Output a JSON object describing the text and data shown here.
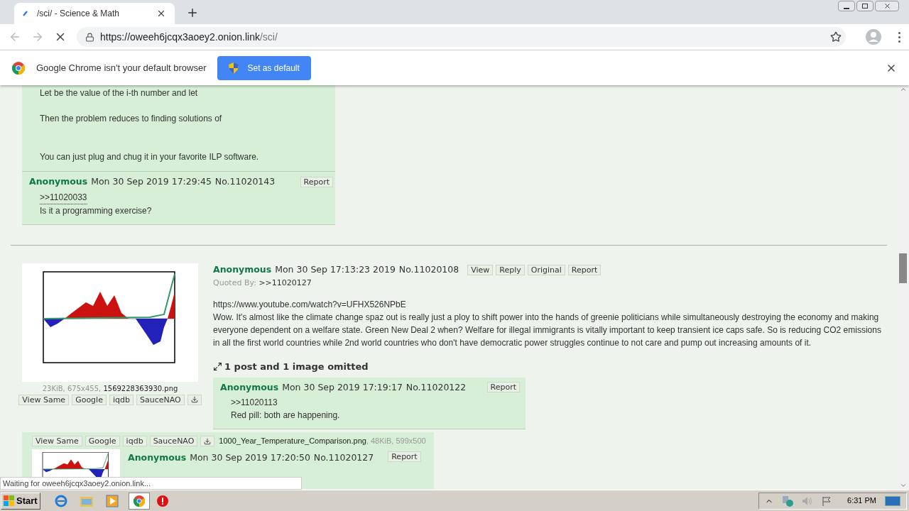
{
  "browser": {
    "tab_title": "/sci/ - Science & Math",
    "url_host": "https://oweeh6jcqx3aoey2.onion.link",
    "url_path": "/sci/",
    "infobar_text": "Google Chrome isn't your default browser",
    "infobar_button": "Set as default"
  },
  "top_reply": {
    "lines": [
      "Let be the value of the i-th number and let",
      "Then the problem reduces to finding solutions of",
      "You can just plug and chug it in your favorite ILP software."
    ]
  },
  "reply_a": {
    "name": "Anonymous",
    "date": "Mon 30 Sep 2019 17:29:45",
    "number": "No.11020143",
    "report": "Report",
    "quote": ">>11020033",
    "text": "Is it a programming exercise?"
  },
  "op": {
    "file_meta": "23KiB, 675x455, ",
    "file_name": "1569228363930.png",
    "file_buttons": [
      "View Same",
      "Google",
      "iqdb",
      "SauceNAO"
    ],
    "name": "Anonymous",
    "date": "Mon 30 Sep 17:13:23 2019",
    "number": "No.11020108",
    "actions": [
      "View",
      "Reply",
      "Original",
      "Report"
    ],
    "quoted_by_label": "Quoted By:",
    "quoted_by": ">>11020127",
    "url": "https://www.youtube.com/watch?v=UFHX526NPbE",
    "body": "Wow. It's almost like the climate change spaz out is really just a ploy to shift power into the hands of greenie politicians while simultaneously destroying the economy and making everyone dependent on a welfare state. Green New Deal 2 when? Welfare for illegal immigrants is vitally important to keep transient ice caps safe. So is reducing CO2 emissions in all the first world countries while 2nd world countries who don't have democratic power struggles continue to not care and pump out increasing amounts of it.",
    "omitted": "1 post and 1 image omitted"
  },
  "reply_b": {
    "name": "Anonymous",
    "date": "Mon 30 Sep 2019 17:19:17",
    "number": "No.11020122",
    "report": "Report",
    "quote": ">>11020113",
    "text": "Red pill: both are happening."
  },
  "reply_c": {
    "file_buttons": [
      "View Same",
      "Google",
      "iqdb",
      "SauceNAO"
    ],
    "file_name": "1000_Year_Temperature_Comparison.png",
    "file_meta": ", 48KiB, 599x500",
    "name": "Anonymous",
    "date": "Mon 30 Sep 2019 17:20:50",
    "number": "No.11020127",
    "report": "Report"
  },
  "status_text": "Waiting for oweeh6jcqx3aoey2.onion.link...",
  "taskbar": {
    "start": "Start",
    "clock": "6:31 PM"
  }
}
